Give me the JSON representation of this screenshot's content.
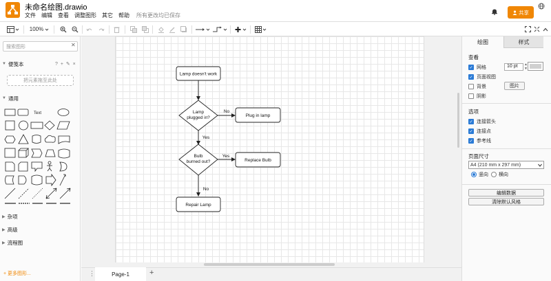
{
  "app": {
    "title": "未命名绘图.drawio",
    "brand_color": "#f08705"
  },
  "menu": {
    "items": [
      "文件",
      "编辑",
      "查看",
      "调整图形",
      "其它",
      "帮助"
    ],
    "saved_status": "所有更改均已保存"
  },
  "header": {
    "share_label": "共享"
  },
  "toolbar": {
    "zoom": "100%"
  },
  "sidebar": {
    "search_placeholder": "搜索图形",
    "scratchpad_title": "便笺本",
    "scratchpad_icons": "? + ✎ ×",
    "drop_hint": "把元素拖至此处",
    "sections": {
      "general": "通用",
      "misc": "杂项",
      "advanced": "高级",
      "flowchart": "流程图"
    },
    "text_shape_label": "Text",
    "more_shapes": "+ 更多图形..."
  },
  "diagram": {
    "nodes": {
      "start": "Lamp doesn't work",
      "plugged": [
        "Lamp",
        "plugged in?"
      ],
      "plug_in": "Plug in lamp",
      "burned": [
        "Bulb",
        "burned out?"
      ],
      "replace": "Replace Bulb",
      "repair": "Repair Lamp"
    },
    "edge_labels": {
      "no1": "No",
      "yes1": "Yes",
      "yes2": "Yes",
      "no2": "No"
    }
  },
  "pages": {
    "tabs": [
      "Page-1"
    ]
  },
  "panel": {
    "tabs": {
      "draw": "绘图",
      "style": "样式"
    },
    "view": {
      "title": "查看",
      "grid": {
        "label": "网格",
        "checked": true,
        "size": "10 pt"
      },
      "page_view": {
        "label": "页面视图",
        "checked": true
      },
      "background": {
        "label": "背景",
        "checked": false,
        "button": "图片"
      },
      "shadow": {
        "label": "阴影",
        "checked": false
      }
    },
    "options": {
      "title": "选项",
      "connection_arrows": {
        "label": "连接箭头",
        "checked": true
      },
      "connection_points": {
        "label": "连接点",
        "checked": true
      },
      "guides": {
        "label": "参考线",
        "checked": true
      }
    },
    "paper": {
      "title": "页面尺寸",
      "size": "A4 (210 mm x 297 mm)",
      "portrait": "竖向",
      "landscape": "横向",
      "orientation": "portrait"
    },
    "buttons": {
      "edit_data": "编辑数据",
      "clear_style": "清除默认风格"
    }
  }
}
